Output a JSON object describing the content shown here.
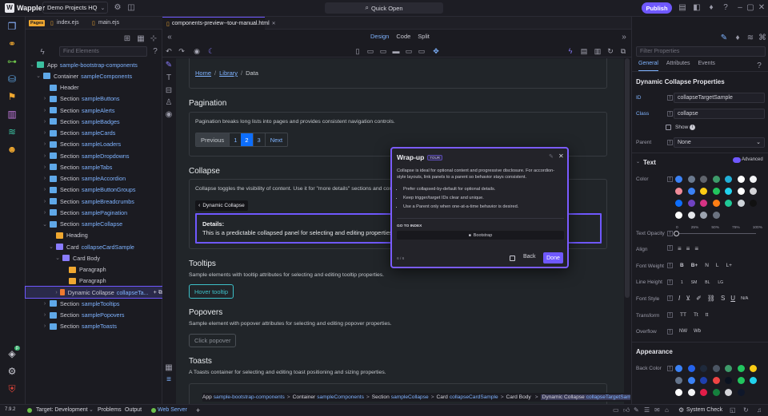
{
  "app": {
    "name": "Wappler",
    "project": "Demo Projects HQ",
    "quick_open": "Quick Open",
    "publish": "Publish"
  },
  "tabs": {
    "pages_badge": "Pages",
    "items": [
      "index.ejs",
      "main.ejs",
      "components-preview--tour-manual.html"
    ]
  },
  "tree": {
    "search_placeholder": "Find Elements",
    "rows": [
      {
        "type": "App",
        "id": "sample-bootstrap-components"
      },
      {
        "type": "Container",
        "id": "sampleComponents"
      },
      {
        "type": "Header",
        "id": ""
      },
      {
        "type": "Section",
        "id": "sampleButtons"
      },
      {
        "type": "Section",
        "id": "sampleAlerts"
      },
      {
        "type": "Section",
        "id": "sampleBadges"
      },
      {
        "type": "Section",
        "id": "sampleCards"
      },
      {
        "type": "Section",
        "id": "sampleLoaders"
      },
      {
        "type": "Section",
        "id": "sampleDropdowns"
      },
      {
        "type": "Section",
        "id": "sampleTabs"
      },
      {
        "type": "Section",
        "id": "sampleAccordion"
      },
      {
        "type": "Section",
        "id": "sampleButtonGroups"
      },
      {
        "type": "Section",
        "id": "sampleBreadcrumbs"
      },
      {
        "type": "Section",
        "id": "samplePagination"
      },
      {
        "type": "Section",
        "id": "sampleCollapse"
      },
      {
        "type": "Heading",
        "id": ""
      },
      {
        "type": "Card",
        "id": "collapseCardSample"
      },
      {
        "type": "Card Body",
        "id": ""
      },
      {
        "type": "Paragraph",
        "id": ""
      },
      {
        "type": "Paragraph",
        "id": ""
      },
      {
        "type": "Dynamic Collapse",
        "id": "collapseTa..."
      },
      {
        "type": "Section",
        "id": "sampleTooltips"
      },
      {
        "type": "Section",
        "id": "samplePopovers"
      },
      {
        "type": "Section",
        "id": "sampleToasts"
      }
    ]
  },
  "canvas": {
    "view_modes": [
      "Design",
      "Code",
      "Split"
    ],
    "breadcrumb": [
      "Home",
      "Library",
      "Data"
    ],
    "pagination": {
      "heading": "Pagination",
      "text": "Pagination breaks long lists into pages and provides consistent navigation controls.",
      "items": [
        "Previous",
        "1",
        "2",
        "3",
        "Next"
      ]
    },
    "collapse": {
      "heading": "Collapse",
      "text": "Collapse toggles the visibility of content. Use it for \"more details\" sections and comp",
      "tag": "Dynamic Collapse",
      "details_label": "Details:",
      "details_text": "This is a predictable collapsed panel for selecting and editing properties"
    },
    "tooltips": {
      "heading": "Tooltips",
      "text": "Sample elements with tooltip attributes for selecting and editing tooltip properties.",
      "button": "Hover tooltip"
    },
    "popovers": {
      "heading": "Popovers",
      "text": "Sample element with popover attributes for selecting and editing popover properties.",
      "button": "Click popover"
    },
    "toasts": {
      "heading": "Toasts",
      "text": "A Toasts container for selecting and editing toast positioning and sizing properties."
    },
    "path": [
      {
        "type": "App",
        "id": "sample-bootstrap-components"
      },
      {
        "type": "Container",
        "id": "sampleComponents"
      },
      {
        "type": "Section",
        "id": "sampleCollapse"
      },
      {
        "type": "Card",
        "id": "collapseCardSample"
      },
      {
        "type": "Card Body",
        "id": ""
      },
      {
        "type": "Dynamic Collapse",
        "id": "collapseTargetSample"
      }
    ]
  },
  "popup": {
    "title": "Wrap-up",
    "badge": "TOUR",
    "intro": "Collapse is ideal for optional content and progressive disclosure. For accordion-style layouts, link panels to a parent so behavior stays consistent.",
    "bullets": [
      "Prefer collapsed-by-default for optional details.",
      "Keep trigger/target IDs clear and unique.",
      "Use a Parent only when one-at-a-time behavior is desired."
    ],
    "go_to_index": "GO TO INDEX",
    "index_item": "Bootstrap",
    "step": "6 / 6",
    "back": "Back",
    "done": "Done"
  },
  "props": {
    "filter_placeholder": "Filter Properties",
    "tabs": [
      "General",
      "Attributes",
      "Events"
    ],
    "title": "Dynamic Collapse Properties",
    "id_label": "ID",
    "id_value": "collapseTargetSample",
    "class_label": "Class",
    "class_value": "collapse",
    "show_label": "Show",
    "parent_label": "Parent",
    "parent_value": "None",
    "text_section": "Text",
    "advanced": "Advanced",
    "color_label": "Color",
    "opacity_label": "Text Opacity",
    "opacity_ticks": [
      "0",
      "25%",
      "50%",
      "75%",
      "100%"
    ],
    "align_label": "Align",
    "weight_label": "Font Weight",
    "weight_values": [
      "B",
      "B+",
      "N",
      "L",
      "L+"
    ],
    "height_label": "Line Height",
    "height_values": [
      "1",
      "SM",
      "BL",
      "LG"
    ],
    "style_label": "Font Style",
    "style_na": "N/A",
    "transform_label": "Transform",
    "transform_values": [
      "TT",
      "Tt",
      "tt"
    ],
    "overflow_label": "Overflow",
    "overflow_values": [
      "NW",
      "Wb"
    ],
    "appearance_section": "Appearance",
    "backcolor_label": "Back Color",
    "text_colors": [
      "#3b82f6",
      "#6b7a8f",
      "#60646c",
      "#3e9b6a",
      "#22b0d8",
      "#ffffff",
      "#f3f4f6",
      "#f08b98",
      "#3b82f6",
      "#facc15",
      "#22c55e",
      "#22d3ee",
      "#ffffff",
      "#d4d4d8",
      "#0d6efd",
      "#6f42c1",
      "#d63384",
      "#fd7e14",
      "#20c997",
      "#ced4da",
      "#111111",
      "#ffffff",
      "#e5e7eb",
      "#9ca3af",
      "#6b7280"
    ],
    "back_colors": [
      "#3b82f6",
      "#2563eb",
      "#1e293b",
      "#4b5563",
      "#3e9b6a",
      "#22c55e",
      "#facc15",
      "#64748b",
      "#3b82f6",
      "#1e40af",
      "#ef4444",
      "#0b1220",
      "#22c55e",
      "#22d3ee",
      "#ffffff",
      "#f3f4f6",
      "#e11d48",
      "#15803d",
      "#d4d4d8",
      "#0f172a"
    ]
  },
  "status": {
    "version": "7.9.2",
    "target": "Target: Development",
    "problems": "Problems",
    "output": "Output",
    "web_server": "Web Server",
    "system_check": "System Check"
  },
  "colors": {
    "accent": "#6f58ff",
    "link": "#7fb3ff",
    "active_page": "#0d6efd"
  }
}
